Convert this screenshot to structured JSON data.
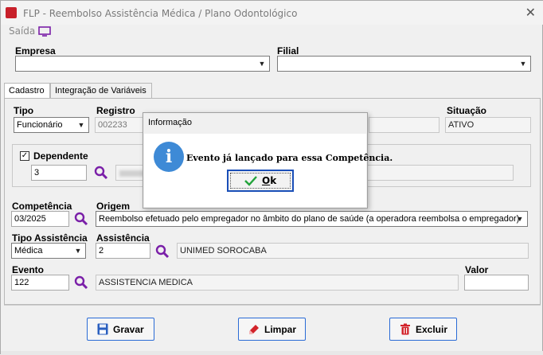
{
  "window": {
    "title": "FLP - Reembolso Assistência Médica / Plano Odontológico"
  },
  "menu": {
    "saida": "Saída"
  },
  "empresa": {
    "label": "Empresa",
    "value": ""
  },
  "filial": {
    "label": "Filial",
    "value": ""
  },
  "tabs": [
    {
      "label": "Cadastro"
    },
    {
      "label": "Integração de Variáveis"
    }
  ],
  "form": {
    "tipo": {
      "label": "Tipo",
      "value": "Funcionário"
    },
    "registro": {
      "label": "Registro",
      "value": "002233"
    },
    "situacao": {
      "label": "Situação",
      "value": "ATIVO"
    },
    "dependente": {
      "label": "Dependente",
      "checked": true,
      "value": "3"
    },
    "competencia": {
      "label": "Competência",
      "value": "03/2025"
    },
    "origem": {
      "label": "Origem",
      "value": "Reembolso efetuado pelo empregador no âmbito do plano de saúde (a operadora reembolsa o empregador)"
    },
    "tipo_assistencia": {
      "label": "Tipo Assistência",
      "value": "Médica"
    },
    "assistencia": {
      "label": "Assistência",
      "code": "2",
      "name": "UNIMED SOROCABA"
    },
    "evento": {
      "label": "Evento",
      "code": "122",
      "name": "ASSISTENCIA MEDICA"
    },
    "valor": {
      "label": "Valor",
      "value": ""
    }
  },
  "buttons": {
    "gravar": "Gravar",
    "limpar": "Limpar",
    "excluir": "Excluir"
  },
  "dialog": {
    "title": "Informação",
    "message": "Evento já lançado para essa Competência.",
    "ok": "Ok",
    "icon": "info-icon"
  },
  "colors": {
    "accent": "#2a6bd6",
    "search": "#7a1fa8",
    "info": "#3e8ad6"
  }
}
